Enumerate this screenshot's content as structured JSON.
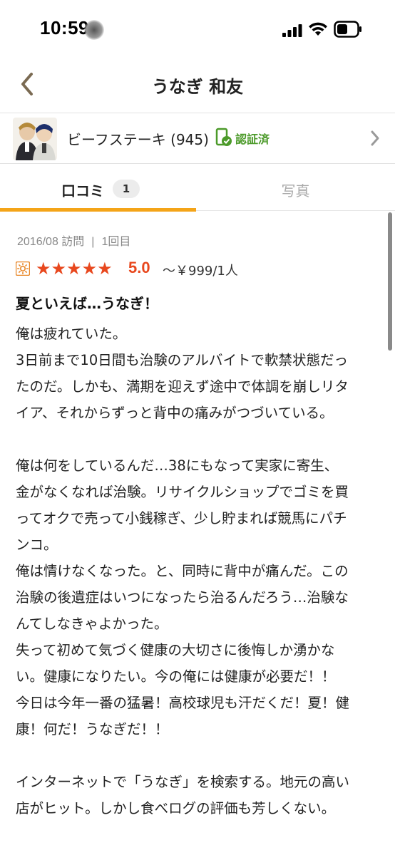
{
  "status_bar": {
    "time": "10:59",
    "icons": [
      "signal-icon",
      "wifi-icon",
      "battery-icon"
    ]
  },
  "header": {
    "title": "うなぎ 和友",
    "back_icon": "chevron-left-icon"
  },
  "reviewer": {
    "name": "ビーフステーキ (945)",
    "verified_label": "認証済",
    "avatar_icon": "avatar",
    "colors": {
      "verified": "#4c9a2a"
    }
  },
  "tabs": [
    {
      "label": "口コミ",
      "badge": "1",
      "active": true
    },
    {
      "label": "写真",
      "active": false
    }
  ],
  "review": {
    "visit_date": "2016/08 訪問",
    "separator": "|",
    "visit_count": "1回目",
    "stars": "★★★★★",
    "rating": "5.0",
    "rating_value": 5.0,
    "price": "～￥999/1人",
    "title": "夏といえば…うなぎ！",
    "body_lines": [
      "俺は疲れていた。",
      "3日前まで10日間も治験のアルバイトで軟禁状態だっ",
      "たのだ。しかも、満期を迎えず途中で体調を崩しリタ",
      "イア、それからずっと背中の痛みがつづいている。",
      "",
      "俺は何をしているんだ…38にもなって実家に寄生、",
      "金がなくなれば治験。リサイクルショップでゴミを買",
      "ってオクで売って小銭稼ぎ、少し貯まれば競馬にパチ",
      "ンコ。",
      "俺は情けなくなった。と、同時に背中が痛んだ。この",
      "治験の後遺症はいつになったら治るんだろう…治験な",
      "んてしなきゃよかった。",
      "失って初めて気づく健康の大切さに後悔しか湧かな",
      "い。健康になりたい。今の俺には健康が必要だ！！",
      "今日は今年一番の猛暑！高校球児も汗だくだ！夏！健",
      "康！何だ！うなぎだ！！",
      "",
      "インターネットで「うなぎ」を検索する。地元の高い",
      "店がヒット。しかし食べログの評価も芳しくない。"
    ]
  },
  "colors": {
    "accent": "#f4a418",
    "stars": "#e8481e"
  }
}
